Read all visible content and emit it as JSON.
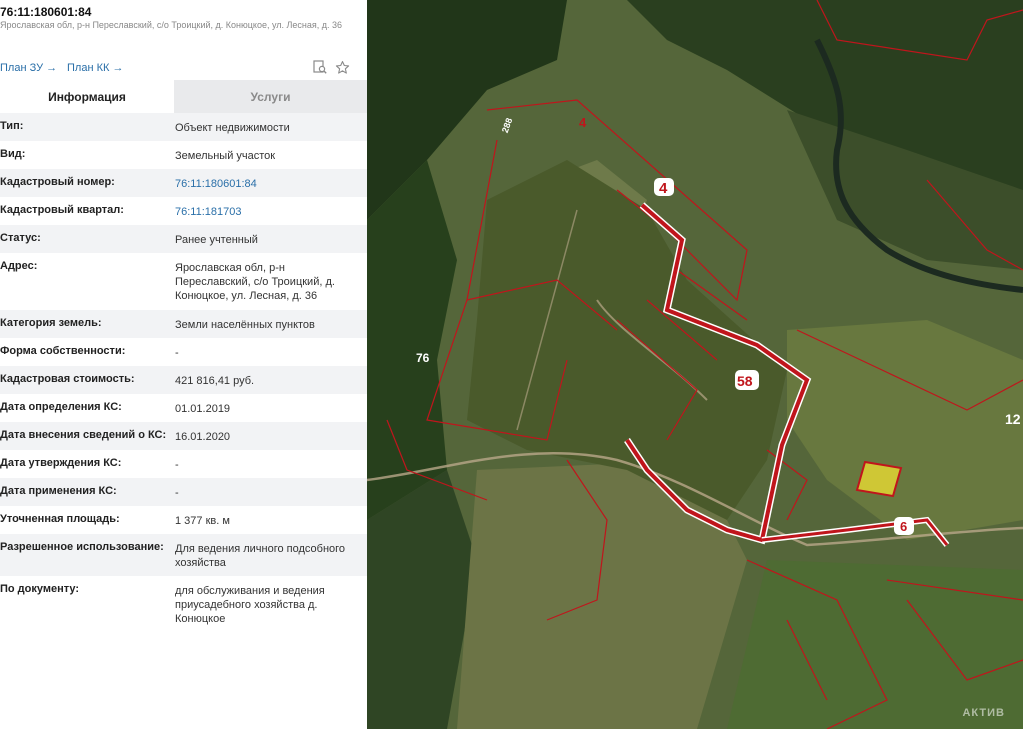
{
  "header": {
    "cadastral_number": "76:11:180601:84",
    "address": "Ярославская обл, р-н Переславский, с/о Троицкий, д. Конюцкое, ул. Лесная, д. 36"
  },
  "links": {
    "plan_zu": "План ЗУ →",
    "plan_kk": "План КК →"
  },
  "icons": {
    "search": "search-document-icon",
    "favorite": "star-icon"
  },
  "tabs": [
    {
      "label": "Информация"
    },
    {
      "label": "Услуги"
    }
  ],
  "rows": [
    {
      "label": "Тип:",
      "value": "Объект недвижимости"
    },
    {
      "label": "Вид:",
      "value": "Земельный участок"
    },
    {
      "label": "Кадастровый номер:",
      "value": "76:11:180601:84"
    },
    {
      "label": "Кадастровый квартал:",
      "value": "76:11:181703"
    },
    {
      "label": "Статус:",
      "value": "Ранее учтенный"
    },
    {
      "label": "Адрес:",
      "value": "Ярославская обл, р-н Переславский, с/о Троицкий, д. Конюцкое, ул. Лесная, д. 36"
    },
    {
      "label": "Категория земель:",
      "value": "Земли населённых пунктов"
    },
    {
      "label": "Форма собственности:",
      "value": "-"
    },
    {
      "label": "Кадастровая стоимость:",
      "value": "421 816,41 руб."
    },
    {
      "label": "Дата определения КС:",
      "value": "01.01.2019"
    },
    {
      "label": "Дата внесения сведений о КС:",
      "value": "16.01.2020"
    },
    {
      "label": "Дата утверждения КС:",
      "value": "-"
    },
    {
      "label": "Дата применения КС:",
      "value": "-"
    },
    {
      "label": "Уточненная площадь:",
      "value": "1 377 кв. м"
    },
    {
      "label": "Разрешенное использование:",
      "value": "Для ведения личного подсобного хозяйства"
    },
    {
      "label": "По документу:",
      "value": "для обслуживания и ведения приусадебного хозяйства д. Конюцкое"
    }
  ],
  "map": {
    "labels": {
      "a": "4",
      "b": "4",
      "c": "58",
      "d": "76",
      "e": "6",
      "f": "12",
      "g": "288"
    },
    "watermark": "АКТИВ",
    "colors": {
      "boundary": "#c0151c",
      "highlight": "#f2e233"
    }
  }
}
